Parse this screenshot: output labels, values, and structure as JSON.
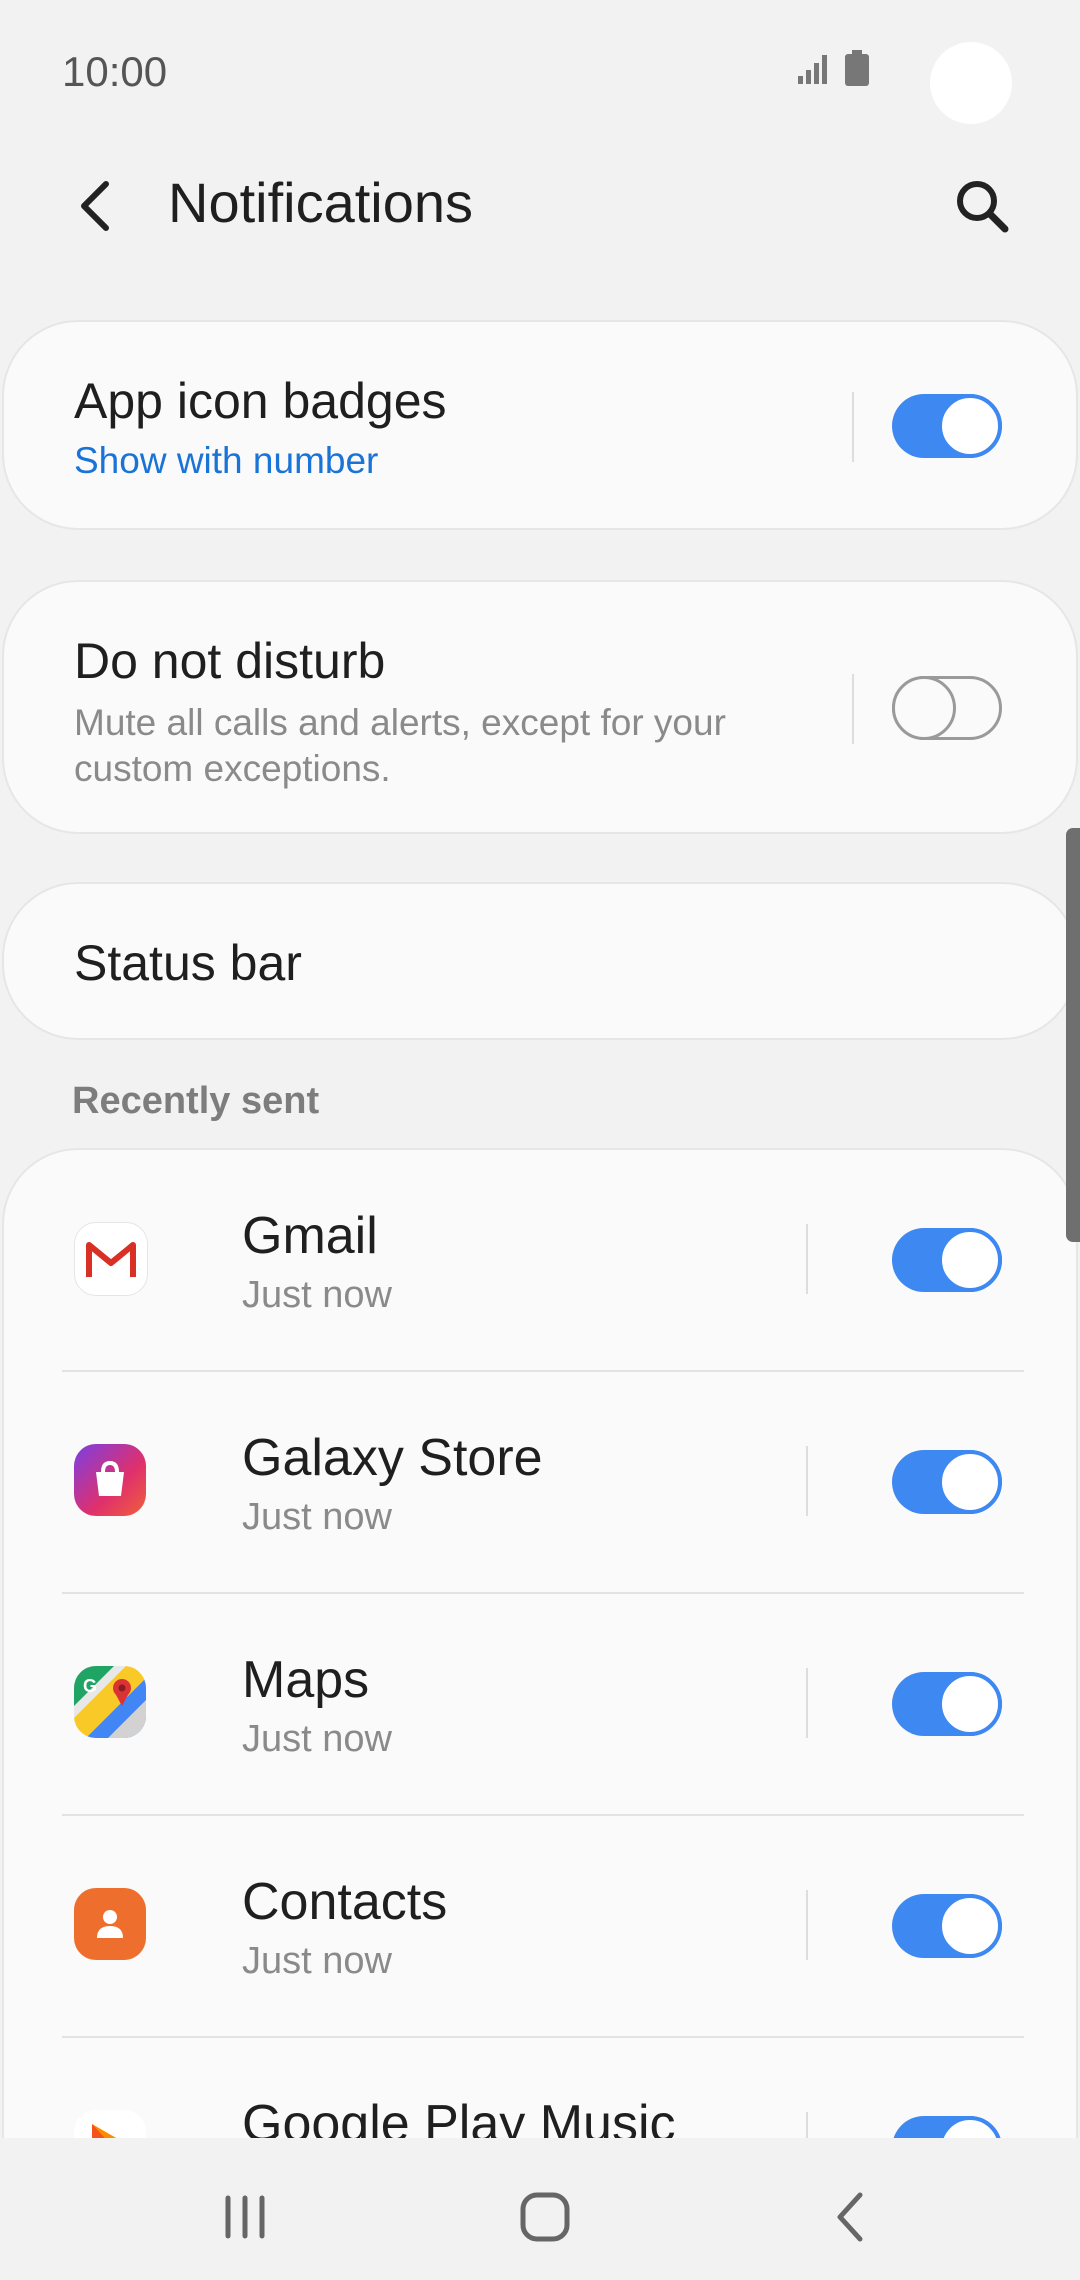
{
  "status_bar": {
    "time": "10:00"
  },
  "header": {
    "title": "Notifications"
  },
  "app_icon_badges": {
    "title": "App icon badges",
    "subtitle": "Show with number",
    "toggle_on": true
  },
  "do_not_disturb": {
    "title": "Do not disturb",
    "subtitle": "Mute all calls and alerts, except for your custom exceptions.",
    "toggle_on": false
  },
  "status_bar_setting": {
    "title": "Status bar"
  },
  "recently_sent": {
    "header": "Recently sent",
    "apps": [
      {
        "name": "Gmail",
        "time": "Just now",
        "icon": "gmail-icon",
        "toggle_on": true
      },
      {
        "name": "Galaxy Store",
        "time": "Just now",
        "icon": "galaxy-store-icon",
        "toggle_on": true
      },
      {
        "name": "Maps",
        "time": "Just now",
        "icon": "maps-icon",
        "toggle_on": true
      },
      {
        "name": "Contacts",
        "time": "Just now",
        "icon": "contacts-icon",
        "toggle_on": true
      },
      {
        "name": "Google Play Music",
        "time": "",
        "icon": "google-play-music-icon",
        "toggle_on": true
      }
    ]
  },
  "colors": {
    "accent": "#3e88f2",
    "link": "#1a73d6",
    "background": "#f2f2f2",
    "card": "#fafafa"
  }
}
